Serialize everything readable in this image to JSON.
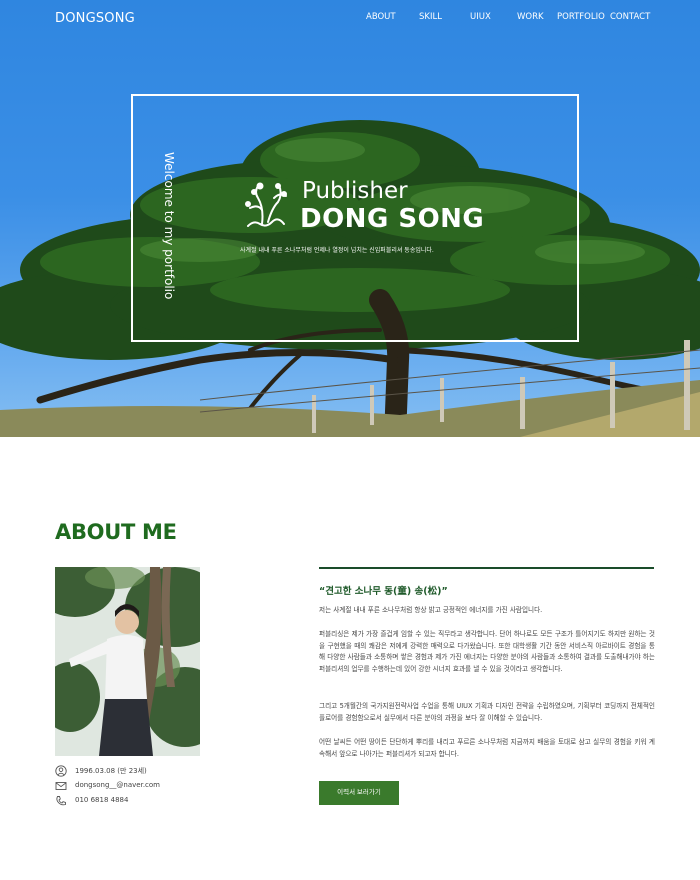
{
  "nav": {
    "logo": "DONGSONG",
    "items": [
      "ABOUT",
      "SKILL",
      "UIUX",
      "WORK",
      "PORTFOLIO",
      "CONTACT"
    ]
  },
  "hero": {
    "side_text": "Welcome to my portfolio",
    "title_line1": "Publisher",
    "title_line2": "DONG SONG",
    "tagline": "사계절 내내 푸른 소나무처럼 언제나 열정이 넘치는 신입퍼블리셔 동송입니다.",
    "emblem_icon": "pine-tree-emblem-icon"
  },
  "about": {
    "title": "ABOUT ME",
    "info": [
      {
        "icon": "user-icon",
        "text": "1996.03.08 (만 23세)"
      },
      {
        "icon": "mail-icon",
        "text": "dongsong__@naver.com"
      },
      {
        "icon": "phone-icon",
        "text": "010 6818 4884"
      }
    ],
    "quote": "“견고한 소나무 동(童) 송(松)”",
    "paragraphs": [
      "저는 사계절 내내 푸른 소나무처럼 항상 밝고 긍정적인 에너지를 가진 사람입니다.",
      "퍼블리싱은 제가 가장 즐겁게 임할 수 있는 직무라고 생각합니다. 단어 하나로도 모든 구조가 틀어지기도 하지만 원하는 것을 구현했을 때의 쾌감은 저에게 강력한 매력으로 다가왔습니다. 또한 대학생활 기간 동안 서비스직 아르바이트 경험을 통해 다양한 사람들과 소통하며 쌓은 경험과 제가 가진 에너지는 다양한 분야의 사람들과 소통하여 결과를 도출해내가야 하는 퍼블리셔의 업무를 수행하는데 있어 강한 시너지 효과를 낼 수 있을 것이라고 생각합니다.",
      "그리고 5개월간의 국가지원전략사업 수업을 통해 UIUX 기획과 디자인 전략을 수립하였으며, 기획부터 코딩까지 전체적인 플로어를 경험함으로서 실무에서 다른 분야의 과정을 보다 잘 이해할 수 있습니다.",
      "어떤 날씨든 어떤 땅이든 단단하게 뿌리를 내리고 푸르른 소나무처럼 지금까지 배움을 토대로 삼고 실무의 경험을 키워 계속해서 앞으로 나아가는 퍼블리셔가 되고자 합니다."
    ],
    "button_label": "이력서 보러가기"
  }
}
